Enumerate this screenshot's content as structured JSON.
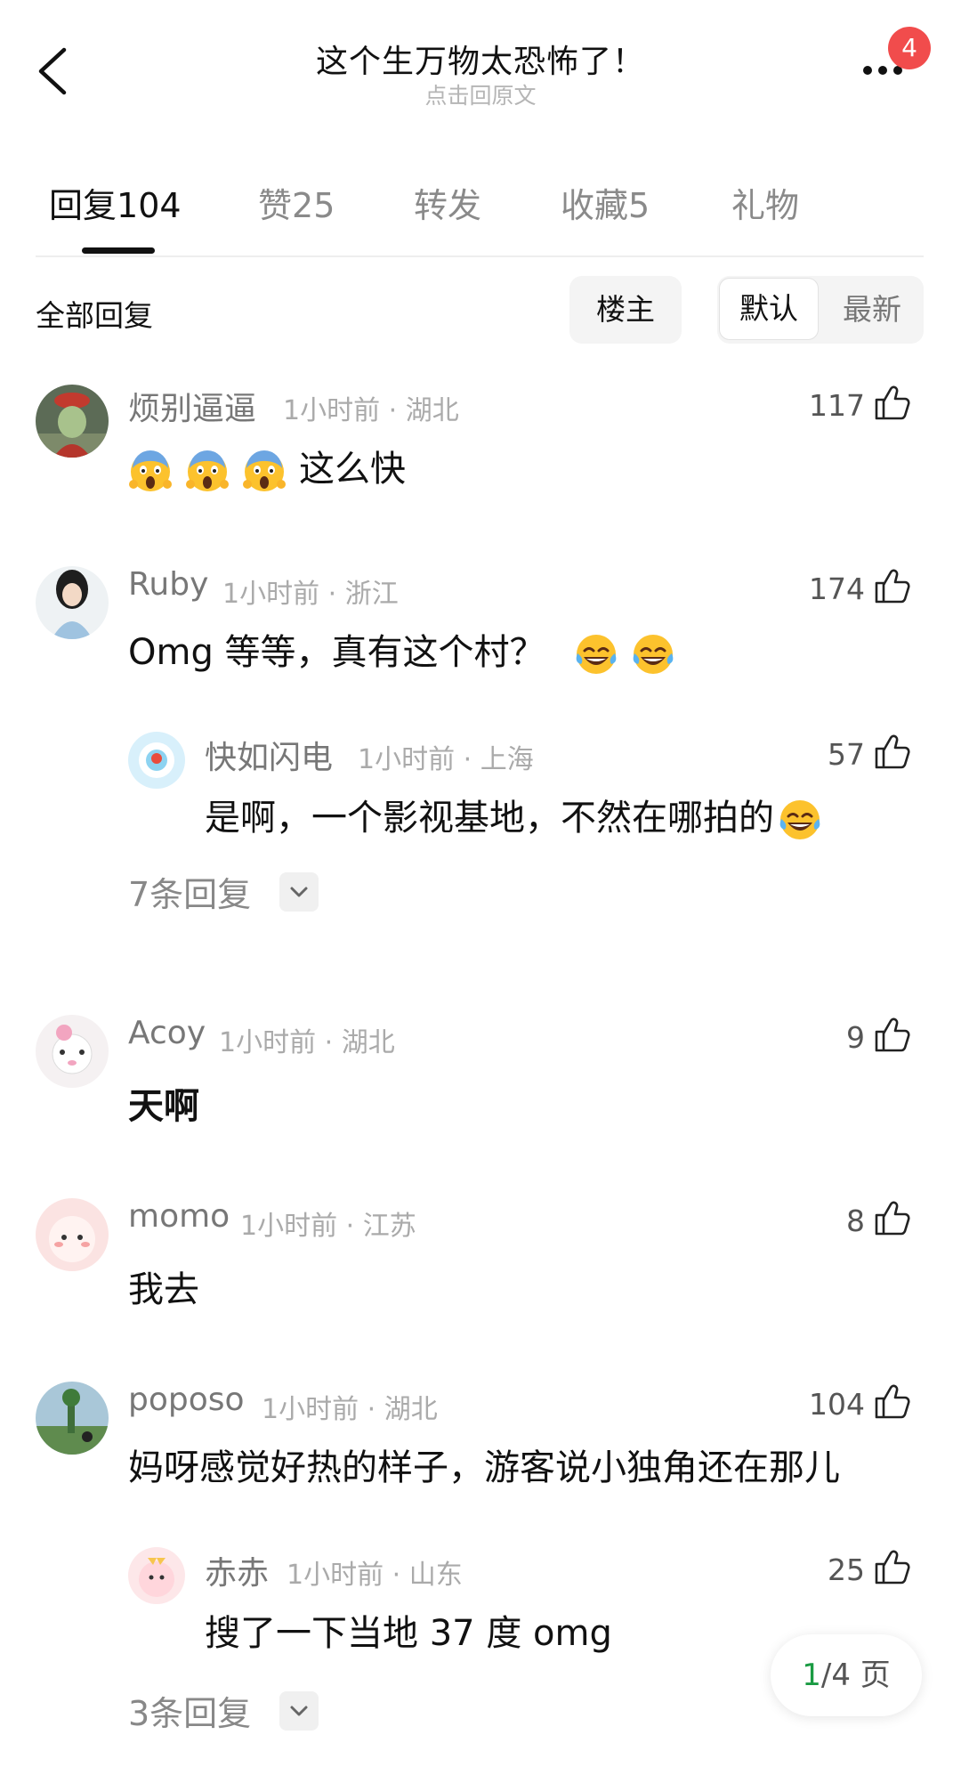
{
  "header": {
    "title": "这个生万物太恐怖了！",
    "subtitle": "点击回原文",
    "badge": "4"
  },
  "tabs": [
    {
      "label": "回复",
      "count": "104",
      "active": true
    },
    {
      "label": "赞",
      "count": "25"
    },
    {
      "label": "转发",
      "count": ""
    },
    {
      "label": "收藏",
      "count": "5"
    },
    {
      "label": "礼物",
      "count": ""
    }
  ],
  "filter": {
    "all_label": "全部回复",
    "owner_label": "楼主",
    "default_label": "默认",
    "newest_label": "最新"
  },
  "comments": [
    {
      "user": "烦别逼逼",
      "meta": "1小时前 · 湖北",
      "likes": "117",
      "text": "这么快",
      "emoji_count": 3,
      "emoji": "scream"
    },
    {
      "user": "Ruby",
      "meta": "1小时前 · 浙江",
      "likes": "174",
      "text": "Omg 等等，真有这个村？",
      "emoji_count": 2,
      "emoji": "tears-of-joy",
      "reply": {
        "user": "快如闪电",
        "meta": "1小时前 · 上海",
        "likes": "57",
        "text": "是啊，一个影视基地，不然在哪拍的"
      },
      "more_replies": "7条回复"
    },
    {
      "user": "Acoy",
      "meta": "1小时前 · 湖北",
      "likes": "9",
      "text": "天啊"
    },
    {
      "user": "momo",
      "meta": "1小时前 · 江苏",
      "likes": "8",
      "text": "我去"
    },
    {
      "user": "poposo",
      "meta": "1小时前 · 湖北",
      "likes": "104",
      "text": "妈呀感觉好热的样子，游客说小独角还在那儿",
      "reply": {
        "user": "赤赤",
        "meta": "1小时前 · 山东",
        "likes": "25",
        "text": "搜了一下当地 37 度 omg"
      },
      "more_replies": "3条回复"
    }
  ],
  "pager": {
    "current": "1",
    "total": "/4 页"
  },
  "colors": {
    "accent_green": "#1a9b43",
    "badge_red": "#f14c4c"
  }
}
